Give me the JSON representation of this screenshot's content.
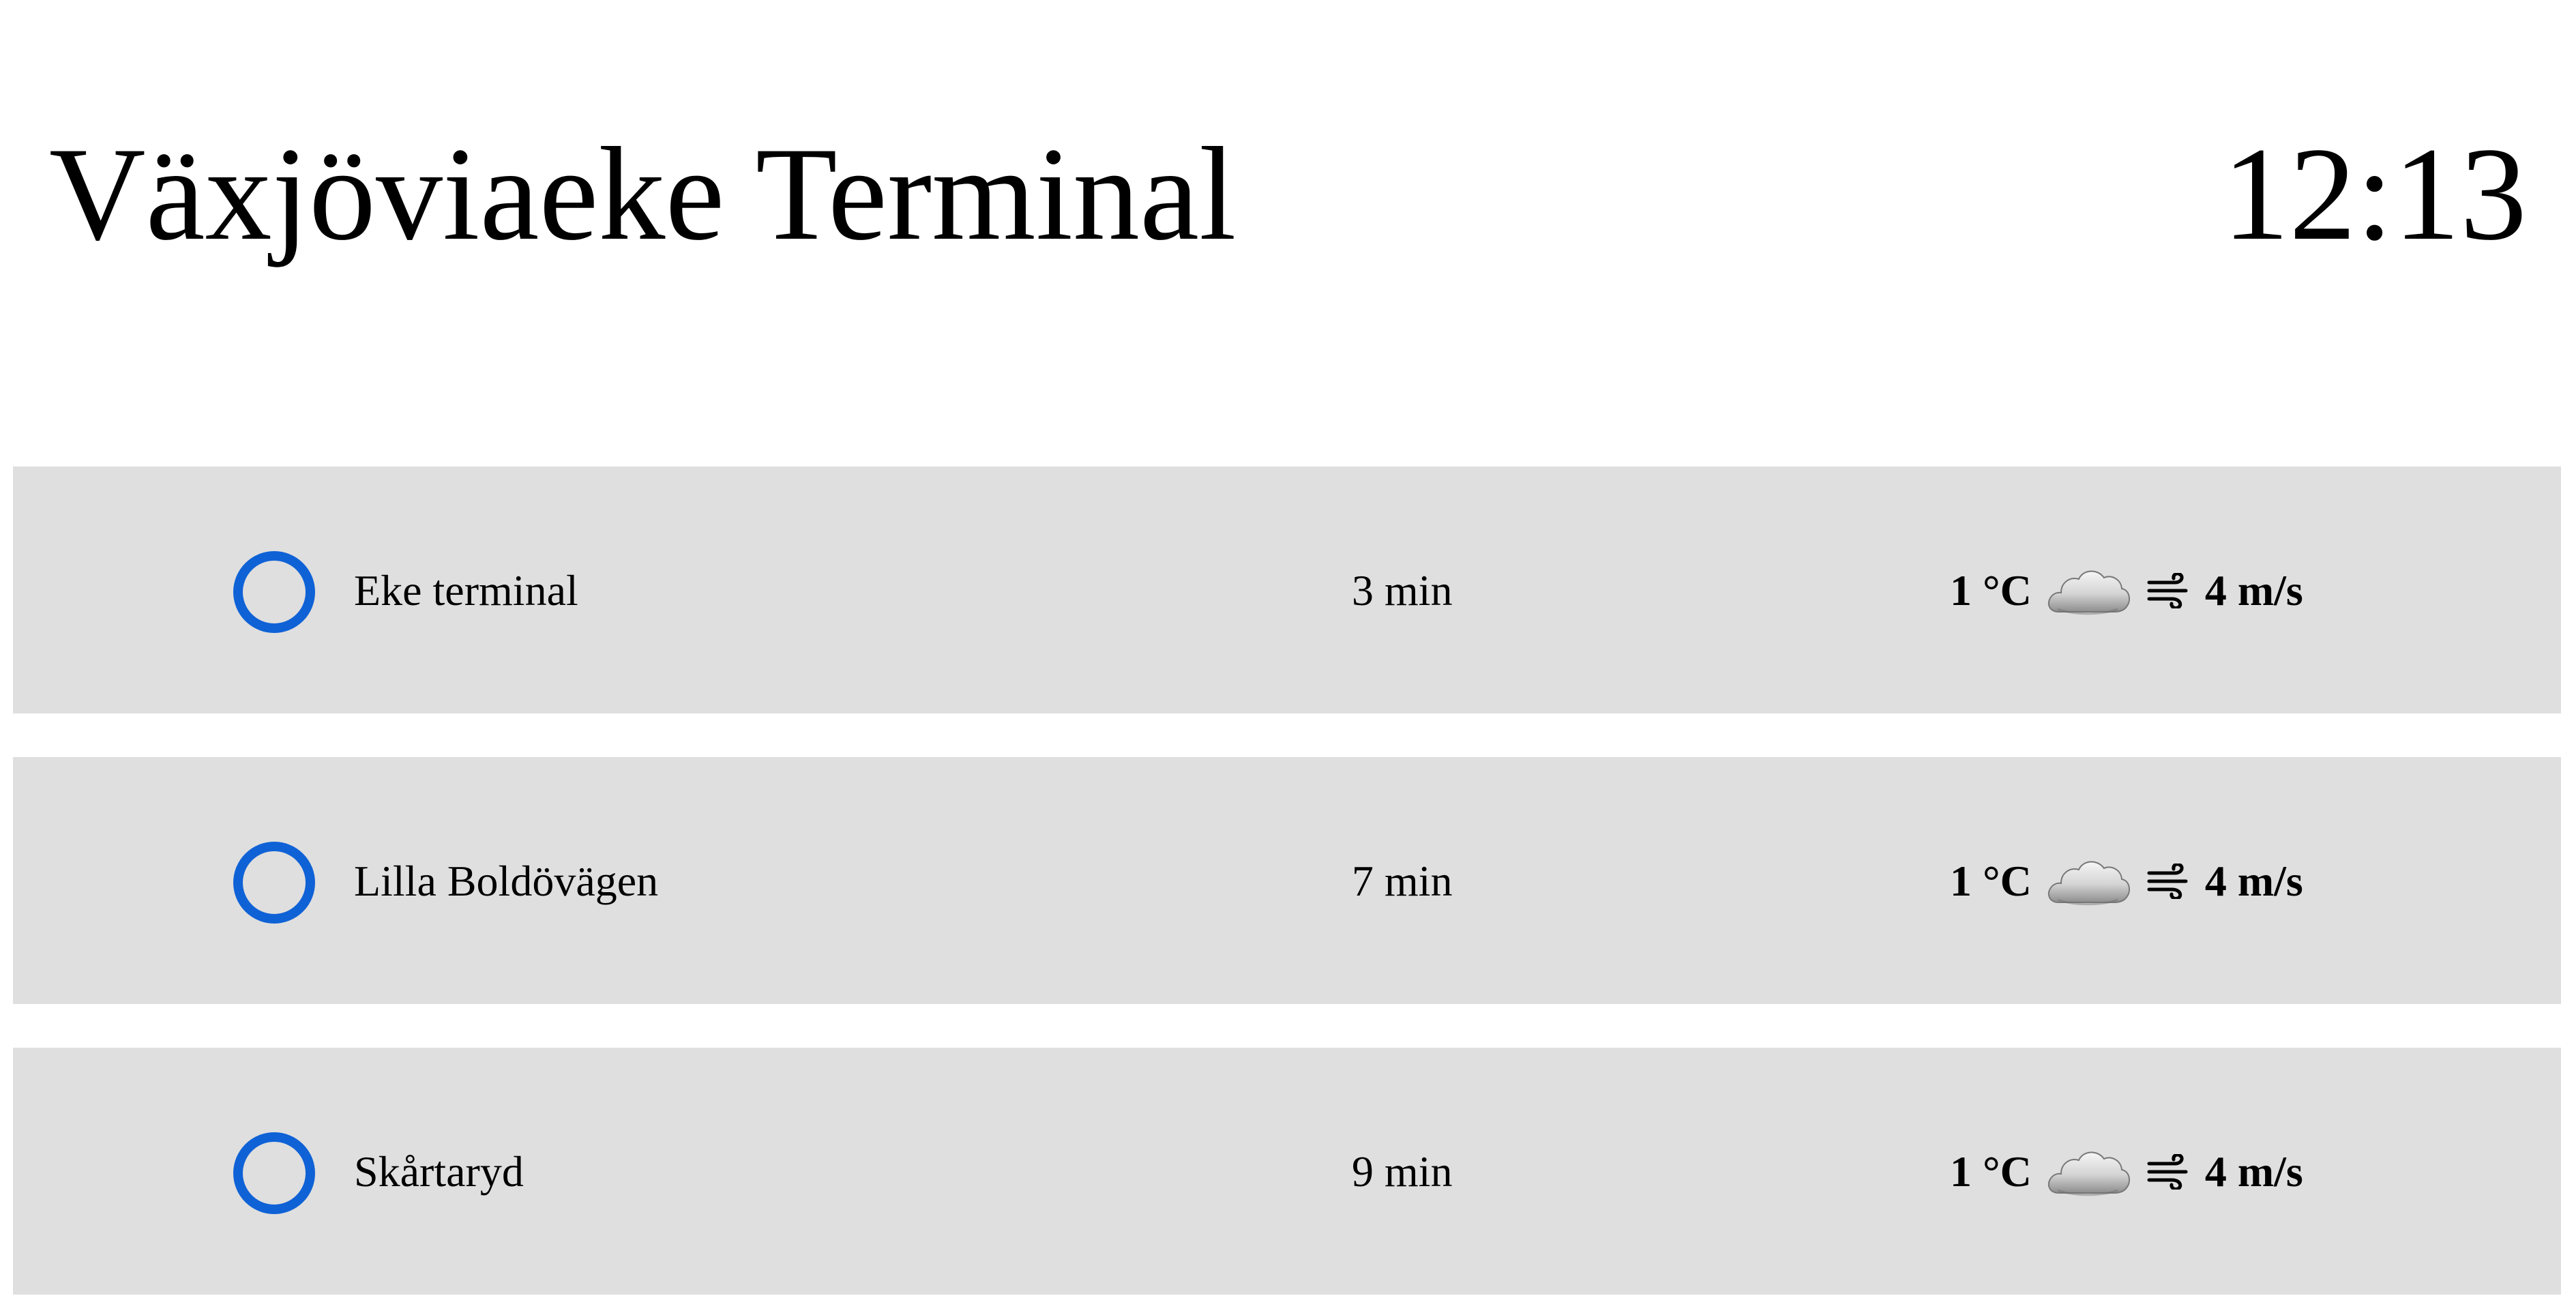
{
  "header": {
    "station_name": "Växjöviaeke Terminal",
    "clock": "12:13"
  },
  "stops": [
    {
      "name": "Eke terminal",
      "time": "3 min",
      "temperature": "1 °C",
      "weather_icon": "cloud-icon",
      "wind_icon": "wind-icon",
      "wind_speed": "4 m/s"
    },
    {
      "name": "Lilla Boldövägen",
      "time": "7 min",
      "temperature": "1 °C",
      "weather_icon": "cloud-icon",
      "wind_icon": "wind-icon",
      "wind_speed": "4 m/s"
    },
    {
      "name": "Skårtaryd",
      "time": "9 min",
      "temperature": "1 °C",
      "weather_icon": "cloud-icon",
      "wind_icon": "wind-icon",
      "wind_speed": "4 m/s"
    }
  ],
  "colors": {
    "stop_marker": "#0f62d6",
    "row_background": "#dfdfdf",
    "page_background": "#ffffff",
    "text": "#000000"
  }
}
